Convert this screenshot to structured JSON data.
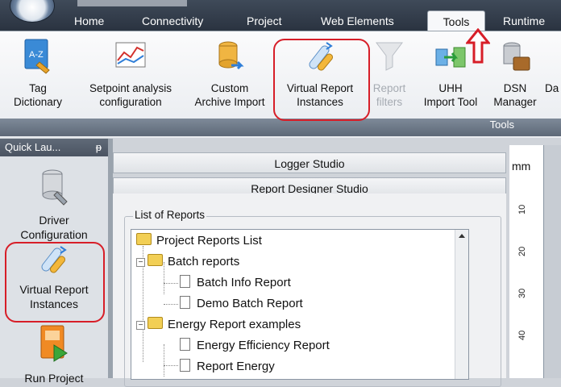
{
  "tabs": [
    "Home",
    "Connectivity",
    "Project",
    "Web Elements",
    "Tools",
    "Runtime"
  ],
  "active_tab": "Tools",
  "ribbon": {
    "buttons": [
      {
        "line1": "Tag",
        "line2": "Dictionary",
        "icon": "tag-dictionary-icon",
        "enabled": true
      },
      {
        "line1": "Setpoint analysis",
        "line2": "configuration",
        "icon": "setpoint-analysis-icon",
        "enabled": true
      },
      {
        "line1": "Custom",
        "line2": "Archive Import",
        "icon": "custom-archive-import-icon",
        "enabled": true
      },
      {
        "line1": "Virtual Report",
        "line2": "Instances",
        "icon": "virtual-report-instances-icon",
        "enabled": true
      },
      {
        "line1": "Report",
        "line2": "filters",
        "icon": "report-filters-icon",
        "enabled": false
      },
      {
        "line1": "UHH",
        "line2": "Import Tool",
        "icon": "uhh-import-tool-icon",
        "enabled": true
      },
      {
        "line1": "DSN",
        "line2": "Manager",
        "icon": "dsn-manager-icon",
        "enabled": true
      },
      {
        "line1": "Da",
        "line2": "",
        "icon": "",
        "enabled": true
      }
    ],
    "group_label": "Tools"
  },
  "quick_launch": {
    "title": "Quick Lau...",
    "pin": "ᵽ",
    "items": [
      {
        "line1": "Driver",
        "line2": "Configuration",
        "icon": "driver-configuration-icon"
      },
      {
        "line1": "Virtual Report",
        "line2": "Instances",
        "icon": "virtual-report-instances-icon"
      },
      {
        "line1": "Run Project",
        "line2": "",
        "icon": "run-project-icon"
      }
    ]
  },
  "studios": {
    "logger": "Logger Studio",
    "report_designer": "Report Designer Studio"
  },
  "reports": {
    "group_title": "List of Reports",
    "tree": [
      {
        "label": "Project Reports List",
        "type": "folder",
        "level": 0
      },
      {
        "label": "Batch reports",
        "type": "folder",
        "level": 1
      },
      {
        "label": "Batch Info Report",
        "type": "report",
        "level": 2
      },
      {
        "label": "Demo Batch Report",
        "type": "report",
        "level": 2
      },
      {
        "label": "Energy Report examples",
        "type": "folder",
        "level": 1
      },
      {
        "label": "Energy Efficiency Report",
        "type": "report",
        "level": 2
      },
      {
        "label": "Report Energy",
        "type": "report",
        "level": 2
      }
    ]
  },
  "ruler": {
    "unit": "mm",
    "ticks": [
      "10",
      "20",
      "30",
      "40"
    ]
  },
  "colors": {
    "highlight": "#d71e28",
    "topbar": "#2f3947"
  }
}
